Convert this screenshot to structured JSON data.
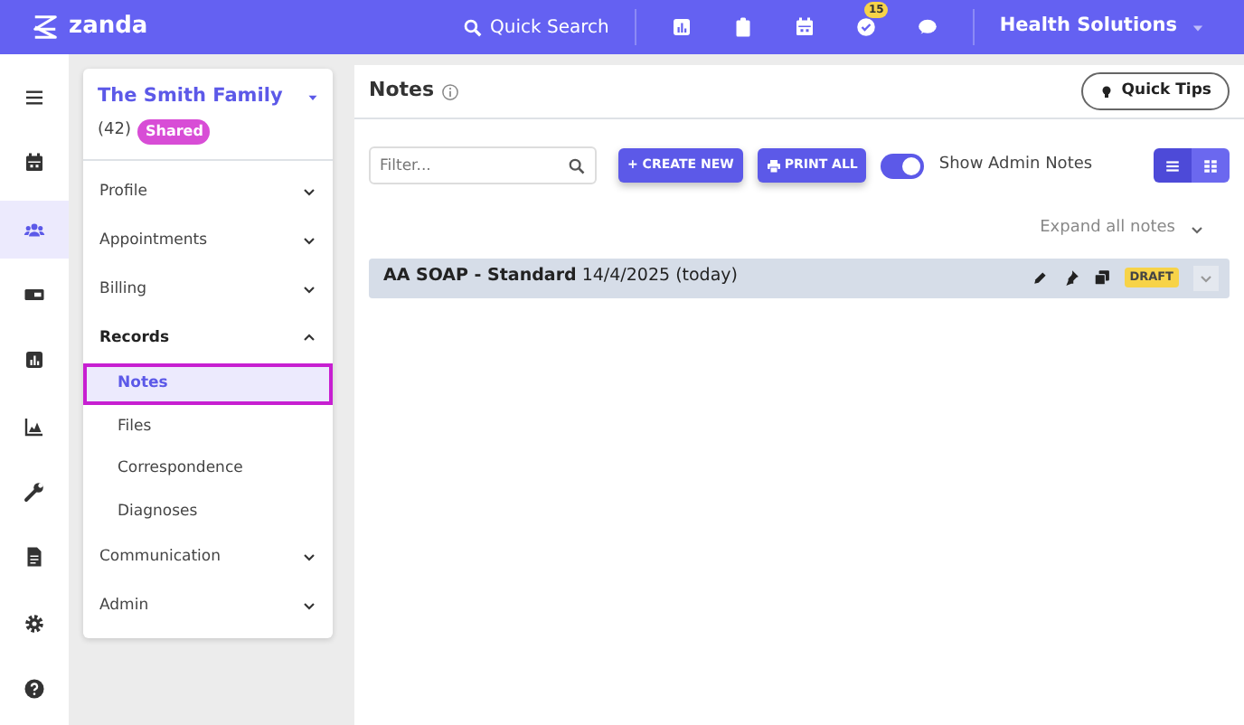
{
  "topbar": {
    "brand": "zanda",
    "search_label": "Quick Search",
    "tools": [
      {
        "kind": "report"
      },
      {
        "kind": "clipboard"
      },
      {
        "kind": "calendar"
      },
      {
        "kind": "tasks",
        "badge": "15"
      },
      {
        "kind": "chat"
      }
    ],
    "org": "Health Solutions"
  },
  "rail": [
    {
      "kind": "menu",
      "selected": false
    },
    {
      "kind": "calendar",
      "selected": false
    },
    {
      "kind": "people",
      "selected": true
    },
    {
      "kind": "money",
      "selected": false
    },
    {
      "kind": "report",
      "selected": false
    },
    {
      "kind": "chart",
      "selected": false
    },
    {
      "kind": "wrench",
      "selected": false
    },
    {
      "kind": "document",
      "selected": false
    },
    {
      "kind": "gear",
      "selected": false
    },
    {
      "kind": "help",
      "selected": false
    }
  ],
  "client": {
    "name": "The Smith Family",
    "count": "(42)",
    "tag": "Shared"
  },
  "nav": [
    {
      "label": "Profile",
      "expanded": false
    },
    {
      "label": "Appointments",
      "expanded": false
    },
    {
      "label": "Billing",
      "expanded": false
    },
    {
      "label": "Records",
      "expanded": true,
      "children": [
        {
          "label": "Notes",
          "selected": true
        },
        {
          "label": "Files",
          "selected": false
        },
        {
          "label": "Correspondence",
          "selected": false
        },
        {
          "label": "Diagnoses",
          "selected": false
        }
      ]
    },
    {
      "label": "Communication",
      "expanded": false
    },
    {
      "label": "Admin",
      "expanded": false
    }
  ],
  "notes": {
    "title": "Notes",
    "quick_tips": "Quick Tips",
    "filter": {
      "placeholder": "Filter..."
    },
    "create": "+ CREATE NEW",
    "print": "PRINT ALL",
    "admin_toggle": {
      "label": "Show Admin Notes",
      "on": true
    },
    "views": [
      {
        "kind": "list",
        "selected": true
      },
      {
        "kind": "grid",
        "selected": false
      }
    ],
    "expand_all": "Expand all notes",
    "items": [
      {
        "title": "AA SOAP - Standard",
        "date": "14/4/2025 (today)",
        "status": "DRAFT"
      }
    ]
  }
}
